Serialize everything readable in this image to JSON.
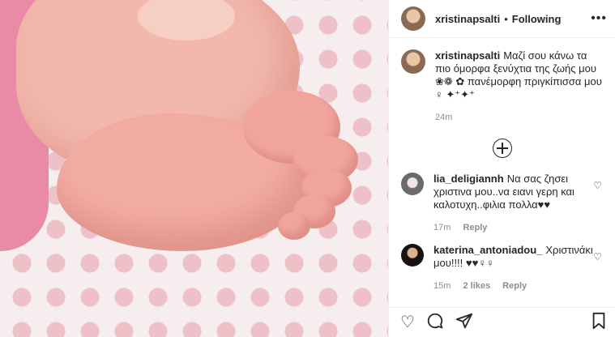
{
  "header": {
    "username": "xristinapsalti",
    "dot": "•",
    "follow_status": "Following",
    "more": "•••"
  },
  "caption": {
    "username": "xristinapsalti",
    "text": "Μαζί σου κάνω τα πιο όμορφα ξενύχτια της ζωής μου ❀❁ ✿ πανέμορφη πριγκίπισσα μου ♀ ✦⁺✦⁺",
    "time": "24m"
  },
  "comments": [
    {
      "username": "lia_deligiannh",
      "text": "Να σας ζησει χριστινα μου..να ειανι γερη και καλοτυχη..φιλια πολλα♥♥",
      "time": "17m",
      "reply": "Reply",
      "likes": ""
    },
    {
      "username": "katerina_antoniadou_",
      "text": "Χριστινάκι μου!!!! ♥♥♀♀",
      "time": "15m",
      "likes": "2 likes",
      "reply": "Reply"
    }
  ],
  "icons": {
    "like": "heart-outline-icon",
    "comment": "comment-icon",
    "share": "paper-plane-icon",
    "save": "bookmark-icon",
    "load_more": "plus-circle-icon"
  }
}
